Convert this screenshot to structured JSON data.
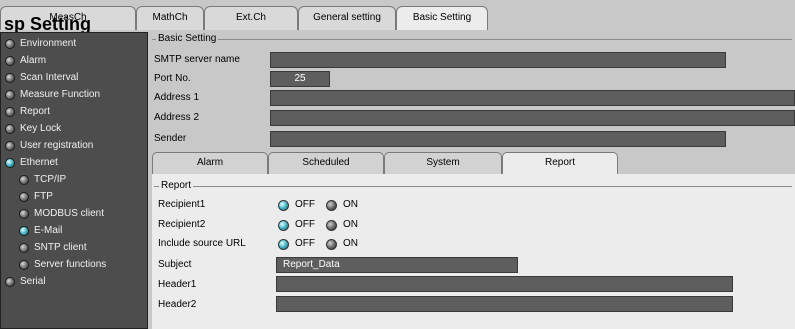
{
  "window": {
    "title_overlay": "sp Setting"
  },
  "top_tabs": [
    {
      "label": "MeasCh"
    },
    {
      "label": "MathCh"
    },
    {
      "label": "Ext.Ch"
    },
    {
      "label": "General setting"
    },
    {
      "label": "Basic Setting",
      "active": true
    }
  ],
  "sidebar": {
    "items": [
      {
        "label": "Environment"
      },
      {
        "label": "Alarm"
      },
      {
        "label": "Scan Interval"
      },
      {
        "label": "Measure Function"
      },
      {
        "label": "Report"
      },
      {
        "label": "Key Lock"
      },
      {
        "label": "User registration"
      },
      {
        "label": "Ethernet",
        "on": true
      },
      {
        "label": "TCP/IP"
      },
      {
        "label": "FTP"
      },
      {
        "label": "MODBUS client"
      },
      {
        "label": "E-Mail",
        "on": true
      },
      {
        "label": "SNTP client"
      },
      {
        "label": "Server functions"
      },
      {
        "label": "Serial"
      }
    ]
  },
  "basic_setting": {
    "group_title": "Basic Setting",
    "fields": [
      {
        "label": "SMTP server name",
        "value": ""
      },
      {
        "label": "Port No.",
        "value": "25"
      },
      {
        "label": "Address 1",
        "value": ""
      },
      {
        "label": "Address 2",
        "value": ""
      },
      {
        "label": "Sender",
        "value": ""
      }
    ]
  },
  "sub_tabs": [
    {
      "label": "Alarm"
    },
    {
      "label": "Scheduled"
    },
    {
      "label": "System"
    },
    {
      "label": "Report",
      "active": true
    }
  ],
  "report": {
    "group_title": "Report",
    "options": [
      {
        "label": "Recipient1",
        "off_label": "OFF",
        "on_label": "ON",
        "selected": "OFF"
      },
      {
        "label": "Recipient2",
        "off_label": "OFF",
        "on_label": "ON",
        "selected": "OFF"
      },
      {
        "label": "Include source URL",
        "off_label": "OFF",
        "on_label": "ON",
        "selected": "OFF"
      }
    ],
    "subject": {
      "label": "Subject",
      "value": "Report_Data"
    },
    "header1": {
      "label": "Header1",
      "value": ""
    },
    "header2": {
      "label": "Header2",
      "value": ""
    }
  },
  "colors": {
    "sidebar_bg": "#4d4d4d",
    "field_bg": "#5e5e5e",
    "led_on": "#45b6c6"
  }
}
